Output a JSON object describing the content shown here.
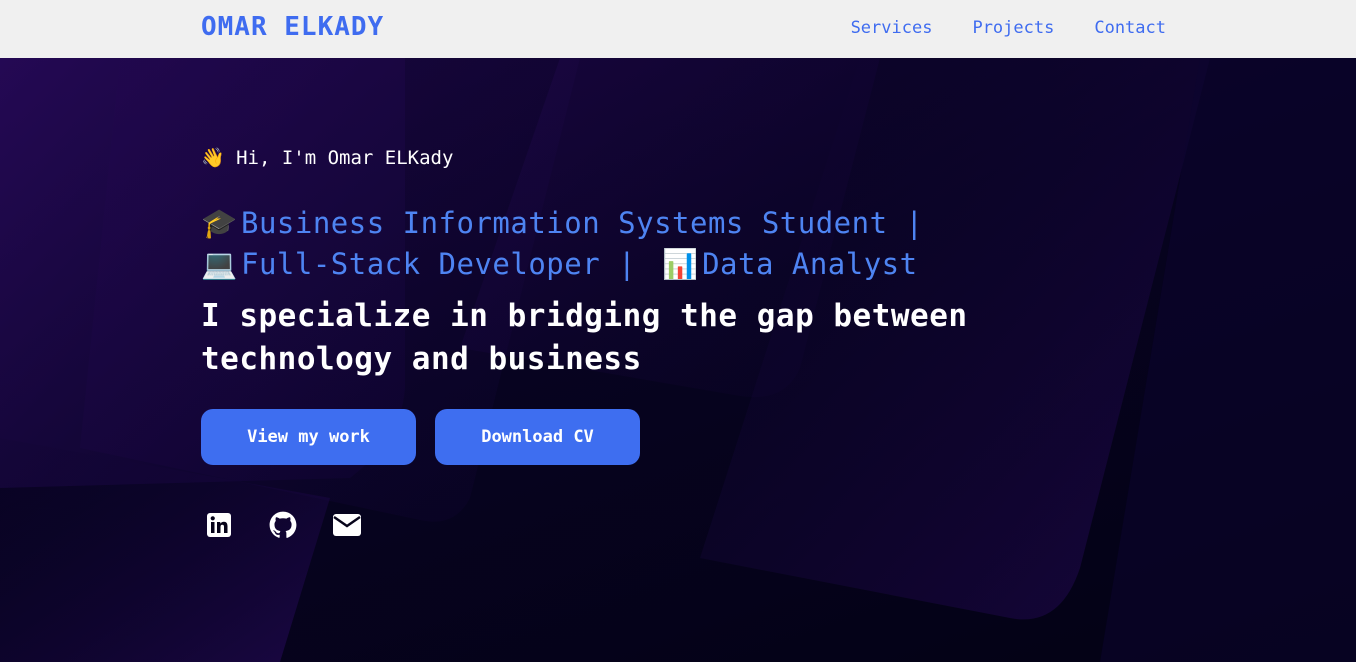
{
  "nav": {
    "brand": "OMAR ELKADY",
    "links": [
      "Services",
      "Projects",
      "Contact"
    ]
  },
  "hero": {
    "greeting_icon": "waving-hand-icon",
    "greeting": "👋 Hi, I'm Omar ELKady",
    "roles": [
      {
        "icon": "graduation-cap-icon",
        "emoji": "🎓",
        "text": "Business Information Systems Student |"
      },
      {
        "icon": "laptop-icon",
        "emoji": "💻",
        "text": "Full-Stack Developer |"
      },
      {
        "icon": "bar-chart-icon",
        "emoji": "📊",
        "text": "Data Analyst"
      }
    ],
    "tagline": "I specialize in bridging the gap between technology and business",
    "buttons": {
      "view_work": "View my work",
      "download_cv": "Download CV"
    },
    "socials": [
      "linkedin-icon",
      "github-icon",
      "email-icon"
    ]
  },
  "colors": {
    "accent": "#3f6cf0",
    "role_text": "#4e84f2",
    "nav_background": "#f0f0f0",
    "hero_background": "#06031a"
  }
}
